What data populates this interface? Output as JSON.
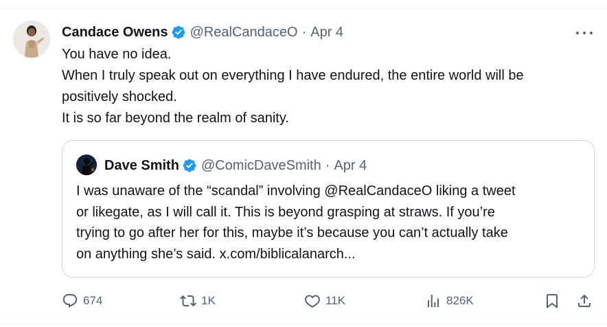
{
  "tweet": {
    "author_name": "Candace Owens",
    "handle": "@RealCandaceO",
    "separator": "·",
    "date": "Apr 4",
    "lines": [
      "You have no idea.",
      "When I truly speak out on everything I have endured, the entire world will be",
      "positively shocked.",
      "It is so far beyond the realm of sanity."
    ]
  },
  "quote": {
    "author_name": "Dave Smith",
    "handle": "@ComicDaveSmith",
    "separator": "·",
    "date": "Apr 4",
    "lines": [
      "I was unaware of the “scandal” involving @RealCandaceO liking a tweet",
      "or likegate, as I will call it. This is beyond grasping at straws. If you’re",
      "trying to go after her for this, maybe it’s because you can’t actually take",
      "on anything she’s said. x.com/biblicalanarch..."
    ]
  },
  "actions": {
    "replies": "674",
    "reposts": "1K",
    "likes": "11K",
    "views": "826K"
  },
  "icons": {
    "verified": "verified-badge-icon",
    "more": "more-dots-icon",
    "reply": "reply-bubble-icon",
    "repost": "repost-arrows-icon",
    "like": "heart-icon",
    "views": "bar-chart-icon",
    "bookmark": "bookmark-icon",
    "share": "share-upload-icon"
  },
  "colors": {
    "verified_blue": "#1d9bf0",
    "text_primary": "#0f1419",
    "text_secondary": "#536471",
    "border": "#cfd9de"
  }
}
